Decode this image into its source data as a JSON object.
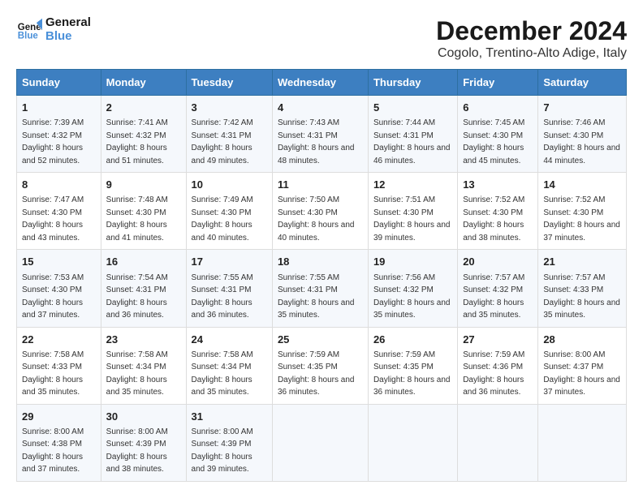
{
  "logo": {
    "line1": "General",
    "line2": "Blue"
  },
  "title": "December 2024",
  "subtitle": "Cogolo, Trentino-Alto Adige, Italy",
  "days_of_week": [
    "Sunday",
    "Monday",
    "Tuesday",
    "Wednesday",
    "Thursday",
    "Friday",
    "Saturday"
  ],
  "weeks": [
    [
      {
        "day": "1",
        "sunrise": "7:39 AM",
        "sunset": "4:32 PM",
        "daylight": "8 hours and 52 minutes."
      },
      {
        "day": "2",
        "sunrise": "7:41 AM",
        "sunset": "4:32 PM",
        "daylight": "8 hours and 51 minutes."
      },
      {
        "day": "3",
        "sunrise": "7:42 AM",
        "sunset": "4:31 PM",
        "daylight": "8 hours and 49 minutes."
      },
      {
        "day": "4",
        "sunrise": "7:43 AM",
        "sunset": "4:31 PM",
        "daylight": "8 hours and 48 minutes."
      },
      {
        "day": "5",
        "sunrise": "7:44 AM",
        "sunset": "4:31 PM",
        "daylight": "8 hours and 46 minutes."
      },
      {
        "day": "6",
        "sunrise": "7:45 AM",
        "sunset": "4:30 PM",
        "daylight": "8 hours and 45 minutes."
      },
      {
        "day": "7",
        "sunrise": "7:46 AM",
        "sunset": "4:30 PM",
        "daylight": "8 hours and 44 minutes."
      }
    ],
    [
      {
        "day": "8",
        "sunrise": "7:47 AM",
        "sunset": "4:30 PM",
        "daylight": "8 hours and 43 minutes."
      },
      {
        "day": "9",
        "sunrise": "7:48 AM",
        "sunset": "4:30 PM",
        "daylight": "8 hours and 41 minutes."
      },
      {
        "day": "10",
        "sunrise": "7:49 AM",
        "sunset": "4:30 PM",
        "daylight": "8 hours and 40 minutes."
      },
      {
        "day": "11",
        "sunrise": "7:50 AM",
        "sunset": "4:30 PM",
        "daylight": "8 hours and 40 minutes."
      },
      {
        "day": "12",
        "sunrise": "7:51 AM",
        "sunset": "4:30 PM",
        "daylight": "8 hours and 39 minutes."
      },
      {
        "day": "13",
        "sunrise": "7:52 AM",
        "sunset": "4:30 PM",
        "daylight": "8 hours and 38 minutes."
      },
      {
        "day": "14",
        "sunrise": "7:52 AM",
        "sunset": "4:30 PM",
        "daylight": "8 hours and 37 minutes."
      }
    ],
    [
      {
        "day": "15",
        "sunrise": "7:53 AM",
        "sunset": "4:30 PM",
        "daylight": "8 hours and 37 minutes."
      },
      {
        "day": "16",
        "sunrise": "7:54 AM",
        "sunset": "4:31 PM",
        "daylight": "8 hours and 36 minutes."
      },
      {
        "day": "17",
        "sunrise": "7:55 AM",
        "sunset": "4:31 PM",
        "daylight": "8 hours and 36 minutes."
      },
      {
        "day": "18",
        "sunrise": "7:55 AM",
        "sunset": "4:31 PM",
        "daylight": "8 hours and 35 minutes."
      },
      {
        "day": "19",
        "sunrise": "7:56 AM",
        "sunset": "4:32 PM",
        "daylight": "8 hours and 35 minutes."
      },
      {
        "day": "20",
        "sunrise": "7:57 AM",
        "sunset": "4:32 PM",
        "daylight": "8 hours and 35 minutes."
      },
      {
        "day": "21",
        "sunrise": "7:57 AM",
        "sunset": "4:33 PM",
        "daylight": "8 hours and 35 minutes."
      }
    ],
    [
      {
        "day": "22",
        "sunrise": "7:58 AM",
        "sunset": "4:33 PM",
        "daylight": "8 hours and 35 minutes."
      },
      {
        "day": "23",
        "sunrise": "7:58 AM",
        "sunset": "4:34 PM",
        "daylight": "8 hours and 35 minutes."
      },
      {
        "day": "24",
        "sunrise": "7:58 AM",
        "sunset": "4:34 PM",
        "daylight": "8 hours and 35 minutes."
      },
      {
        "day": "25",
        "sunrise": "7:59 AM",
        "sunset": "4:35 PM",
        "daylight": "8 hours and 36 minutes."
      },
      {
        "day": "26",
        "sunrise": "7:59 AM",
        "sunset": "4:35 PM",
        "daylight": "8 hours and 36 minutes."
      },
      {
        "day": "27",
        "sunrise": "7:59 AM",
        "sunset": "4:36 PM",
        "daylight": "8 hours and 36 minutes."
      },
      {
        "day": "28",
        "sunrise": "8:00 AM",
        "sunset": "4:37 PM",
        "daylight": "8 hours and 37 minutes."
      }
    ],
    [
      {
        "day": "29",
        "sunrise": "8:00 AM",
        "sunset": "4:38 PM",
        "daylight": "8 hours and 37 minutes."
      },
      {
        "day": "30",
        "sunrise": "8:00 AM",
        "sunset": "4:39 PM",
        "daylight": "8 hours and 38 minutes."
      },
      {
        "day": "31",
        "sunrise": "8:00 AM",
        "sunset": "4:39 PM",
        "daylight": "8 hours and 39 minutes."
      },
      null,
      null,
      null,
      null
    ]
  ]
}
